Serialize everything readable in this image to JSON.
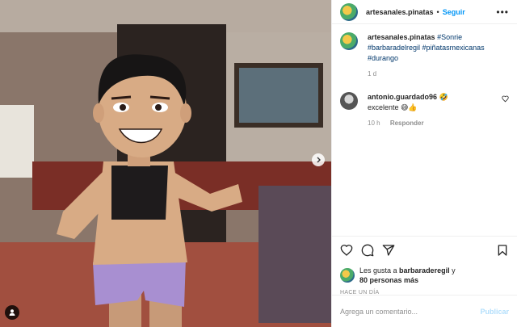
{
  "post": {
    "username": "artesanales.pinatas",
    "separator": "•",
    "follow_label": "Seguir",
    "more_label": "•••"
  },
  "caption": {
    "username": "artesanales.pinatas",
    "text": "#Sonrie #barbaradelregil #piñatasmexicanas #durango",
    "time": "1 d"
  },
  "comment": {
    "username": "antonio.guardado96",
    "emoji": "🤣",
    "text": "excelente 😅👍",
    "time": "10 h",
    "reply_label": "Responder"
  },
  "likes": {
    "prefix": "Les gusta a ",
    "user": "barbaraderegil",
    "joiner": " y",
    "others": "80 personas más"
  },
  "posted_ago": "HACE UN DÍA",
  "comment_input": {
    "placeholder": "Agrega un comentario..."
  },
  "publish_label": "Publicar",
  "colors": {
    "accent": "#0095f6",
    "hashtag": "#00376b",
    "muted": "#8e8e8e",
    "disabled_accent": "#b2dffc"
  },
  "icons": [
    "heart-icon",
    "comment-icon",
    "share-icon",
    "bookmark-icon",
    "more-icon",
    "chevron-right-icon",
    "user-tag-icon"
  ]
}
